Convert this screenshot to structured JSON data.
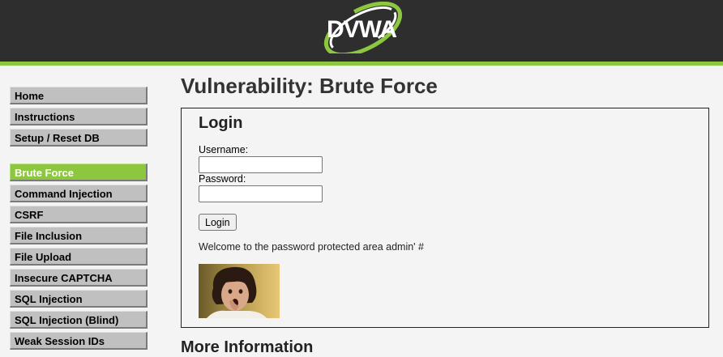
{
  "header": {
    "logo_text": "DVWA",
    "accent_color": "#8dc63f",
    "background_color": "#2e2e2e"
  },
  "sidebar": {
    "groups": [
      {
        "items": [
          {
            "label": "Home",
            "selected": false
          },
          {
            "label": "Instructions",
            "selected": false
          },
          {
            "label": "Setup / Reset DB",
            "selected": false
          }
        ]
      },
      {
        "items": [
          {
            "label": "Brute Force",
            "selected": true
          },
          {
            "label": "Command Injection",
            "selected": false
          },
          {
            "label": "CSRF",
            "selected": false
          },
          {
            "label": "File Inclusion",
            "selected": false
          },
          {
            "label": "File Upload",
            "selected": false
          },
          {
            "label": "Insecure CAPTCHA",
            "selected": false
          },
          {
            "label": "SQL Injection",
            "selected": false
          },
          {
            "label": "SQL Injection (Blind)",
            "selected": false
          },
          {
            "label": "Weak Session IDs",
            "selected": false
          }
        ]
      }
    ]
  },
  "main": {
    "title": "Vulnerability: Brute Force",
    "login": {
      "heading": "Login",
      "username_label": "Username:",
      "username_value": "",
      "password_label": "Password:",
      "password_value": "",
      "button_label": "Login",
      "welcome_message": "Welcome to the password protected area admin' #"
    },
    "more_info_heading": "More Information"
  }
}
